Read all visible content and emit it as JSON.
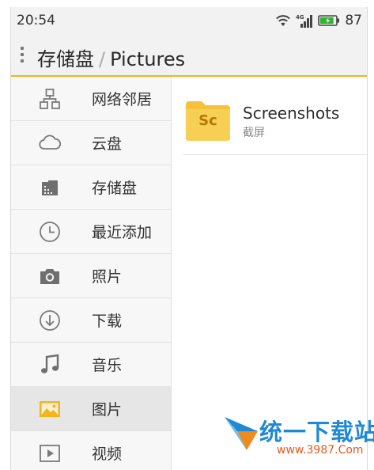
{
  "status_bar": {
    "time": "20:54",
    "network": "4G",
    "battery_level": "87",
    "battery_color": "#2fb52f"
  },
  "app_bar": {
    "breadcrumb": [
      "存储盘",
      "Pictures"
    ],
    "separator": "/",
    "accent_color": "#f5b41a"
  },
  "sidebar": {
    "items": [
      {
        "label": "网络邻居",
        "icon": "network-icon"
      },
      {
        "label": "云盘",
        "icon": "cloud-icon"
      },
      {
        "label": "存储盘",
        "icon": "storage-icon"
      },
      {
        "label": "最近添加",
        "icon": "clock-icon"
      },
      {
        "label": "照片",
        "icon": "camera-icon"
      },
      {
        "label": "下载",
        "icon": "download-icon"
      },
      {
        "label": "音乐",
        "icon": "music-icon"
      },
      {
        "label": "图片",
        "icon": "image-icon",
        "selected": true
      },
      {
        "label": "视频",
        "icon": "video-icon"
      }
    ]
  },
  "files": [
    {
      "name": "Screenshots",
      "subtitle": "截屏",
      "icon_abbr": "Sc",
      "type": "folder"
    }
  ],
  "watermark": {
    "title": "统一下载站",
    "url": "www.3987.Com"
  }
}
